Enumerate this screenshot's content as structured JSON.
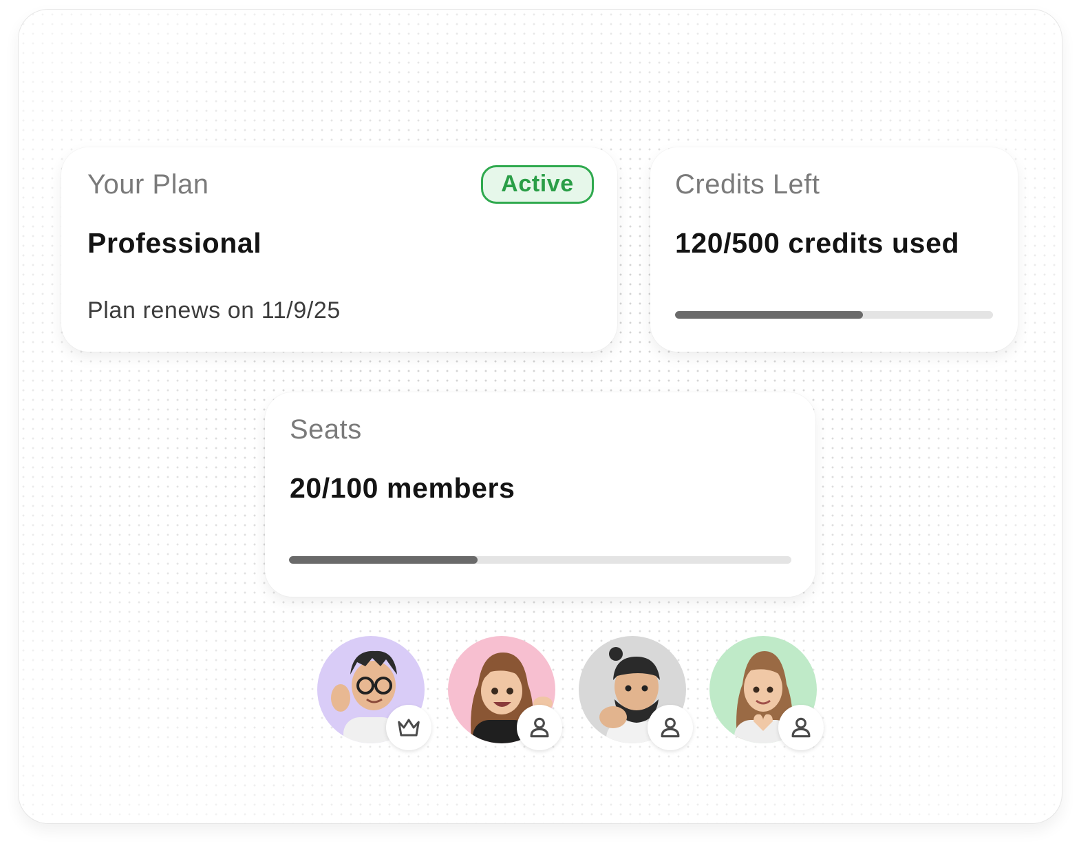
{
  "plan": {
    "label": "Your Plan",
    "status": "Active",
    "name": "Professional",
    "renewal": "Plan renews on 11/9/25"
  },
  "credits": {
    "label": "Credits Left",
    "usage": "120/500 credits used",
    "progress_percent": 59
  },
  "seats": {
    "label": "Seats",
    "usage": "20/100 members",
    "progress_percent": 37.5
  },
  "members": [
    {
      "role_icon": "crown-icon",
      "bg": "#d9ccf7"
    },
    {
      "role_icon": "user-icon",
      "bg": "#f7bfd0"
    },
    {
      "role_icon": "user-icon",
      "bg": "#d8d8d8"
    },
    {
      "role_icon": "user-icon",
      "bg": "#bfeac8"
    }
  ],
  "colors": {
    "active_green": "#2fa94e",
    "active_bg": "#e6f7ea",
    "progress_fill": "#6a6a6a",
    "progress_track": "#e4e4e4"
  }
}
